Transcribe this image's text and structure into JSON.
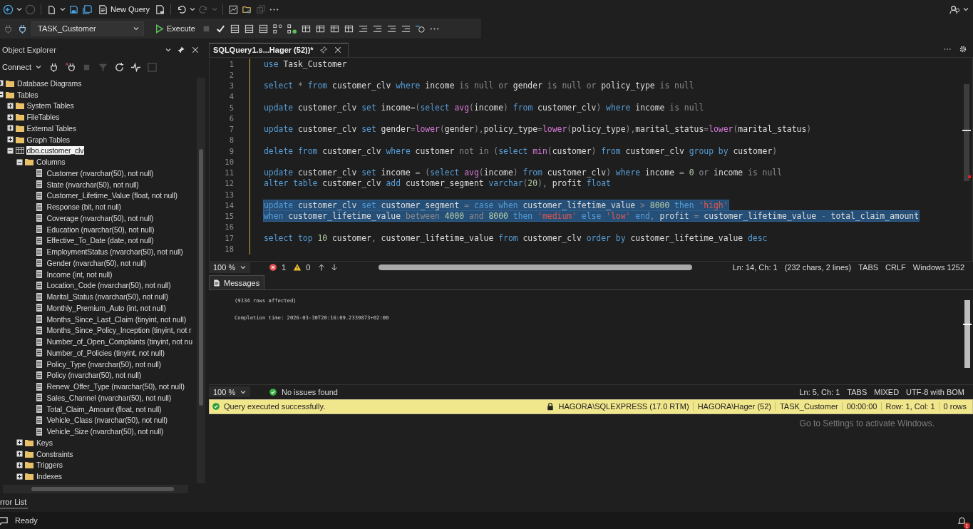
{
  "toolbar": {
    "new_query": "New Query",
    "database": "TASK_Customer",
    "execute": "Execute"
  },
  "object_explorer": {
    "title": "Object Explorer",
    "connect": "Connect",
    "tree": [
      {
        "label": "Database Diagrams",
        "kind": "folder",
        "expanded": false,
        "selected": false
      },
      {
        "label": "Tables",
        "kind": "folder",
        "expanded": true,
        "selected": false,
        "children": [
          {
            "label": "System Tables",
            "kind": "folder",
            "expanded": false,
            "selected": false
          },
          {
            "label": "FileTables",
            "kind": "folder",
            "expanded": false,
            "selected": false
          },
          {
            "label": "External Tables",
            "kind": "folder",
            "expanded": false,
            "selected": false
          },
          {
            "label": "Graph Tables",
            "kind": "folder",
            "expanded": false,
            "selected": false
          },
          {
            "label": "dbo.customer_clv",
            "kind": "table",
            "expanded": true,
            "selected": true,
            "children": [
              {
                "label": "Columns",
                "kind": "folder",
                "expanded": true,
                "selected": false,
                "children": [
                  {
                    "label": "Customer (nvarchar(50), not null)",
                    "kind": "column",
                    "selected": false
                  },
                  {
                    "label": "State (nvarchar(50), not null)",
                    "kind": "column",
                    "selected": false
                  },
                  {
                    "label": "Customer_Lifetime_Value (float, not null)",
                    "kind": "column",
                    "selected": false
                  },
                  {
                    "label": "Response (bit, not null)",
                    "kind": "column",
                    "selected": false
                  },
                  {
                    "label": "Coverage (nvarchar(50), not null)",
                    "kind": "column",
                    "selected": false
                  },
                  {
                    "label": "Education (nvarchar(50), not null)",
                    "kind": "column",
                    "selected": false
                  },
                  {
                    "label": "Effective_To_Date (date, not null)",
                    "kind": "column",
                    "selected": false
                  },
                  {
                    "label": "EmploymentStatus (nvarchar(50), not null)",
                    "kind": "column",
                    "selected": false
                  },
                  {
                    "label": "Gender (nvarchar(50), not null)",
                    "kind": "column",
                    "selected": false
                  },
                  {
                    "label": "Income (int, not null)",
                    "kind": "column",
                    "selected": false
                  },
                  {
                    "label": "Location_Code (nvarchar(50), not null)",
                    "kind": "column",
                    "selected": false
                  },
                  {
                    "label": "Marital_Status (nvarchar(50), not null)",
                    "kind": "column",
                    "selected": false
                  },
                  {
                    "label": "Monthly_Premium_Auto (int, not null)",
                    "kind": "column",
                    "selected": false
                  },
                  {
                    "label": "Months_Since_Last_Claim (tinyint, not null)",
                    "kind": "column",
                    "selected": false
                  },
                  {
                    "label": "Months_Since_Policy_Inception (tinyint, not r",
                    "kind": "column",
                    "selected": false
                  },
                  {
                    "label": "Number_of_Open_Complaints (tinyint, not nu",
                    "kind": "column",
                    "selected": false
                  },
                  {
                    "label": "Number_of_Policies (tinyint, not null)",
                    "kind": "column",
                    "selected": false
                  },
                  {
                    "label": "Policy_Type (nvarchar(50), not null)",
                    "kind": "column",
                    "selected": false
                  },
                  {
                    "label": "Policy (nvarchar(50), not null)",
                    "kind": "column",
                    "selected": false
                  },
                  {
                    "label": "Renew_Offer_Type (nvarchar(50), not null)",
                    "kind": "column",
                    "selected": false
                  },
                  {
                    "label": "Sales_Channel (nvarchar(50), not null)",
                    "kind": "column",
                    "selected": false
                  },
                  {
                    "label": "Total_Claim_Amount (float, not null)",
                    "kind": "column",
                    "selected": false
                  },
                  {
                    "label": "Vehicle_Class (nvarchar(50), not null)",
                    "kind": "column",
                    "selected": false
                  },
                  {
                    "label": "Vehicle_Size (nvarchar(50), not null)",
                    "kind": "column",
                    "selected": false
                  }
                ]
              },
              {
                "label": "Keys",
                "kind": "folder",
                "expanded": false,
                "selected": false
              },
              {
                "label": "Constraints",
                "kind": "folder",
                "expanded": false,
                "selected": false
              },
              {
                "label": "Triggers",
                "kind": "folder",
                "expanded": false,
                "selected": false
              },
              {
                "label": "Indexes",
                "kind": "folder",
                "expanded": false,
                "selected": false
              }
            ]
          }
        ]
      }
    ],
    "error_list_tab": "rror List"
  },
  "editor": {
    "tab": {
      "title": "SQLQuery1.s...Hager (52))*",
      "selected": true
    },
    "lines": [
      {
        "number": "1",
        "selected": false,
        "tokens": [
          {
            "text": "use",
            "kind": "kw"
          },
          {
            "text": " Task_Customer",
            "kind": "id"
          }
        ]
      },
      {
        "number": "2"
      },
      {
        "number": "3",
        "selected": false,
        "tokens": [
          {
            "text": "select",
            "kind": "kw"
          },
          {
            "text": " *",
            "kind": "op"
          },
          {
            "text": " from",
            "kind": "kw"
          },
          {
            "text": " customer_clv",
            "kind": "id"
          },
          {
            "text": " where",
            "kind": "kw"
          },
          {
            "text": " income",
            "kind": "id"
          },
          {
            "text": " is null or",
            "kind": "op"
          },
          {
            "text": " gender",
            "kind": "id"
          },
          {
            "text": " is null or",
            "kind": "op"
          },
          {
            "text": " policy_type",
            "kind": "id"
          },
          {
            "text": " is null",
            "kind": "op"
          }
        ]
      },
      {
        "number": "4"
      },
      {
        "number": "5",
        "selected": false,
        "tokens": [
          {
            "text": "update",
            "kind": "kw"
          },
          {
            "text": " customer_clv",
            "kind": "id"
          },
          {
            "text": " set",
            "kind": "kw"
          },
          {
            "text": " income",
            "kind": "id"
          },
          {
            "text": "=(",
            "kind": "op"
          },
          {
            "text": "select",
            "kind": "kw"
          },
          {
            "text": " avg",
            "kind": "fn"
          },
          {
            "text": "(",
            "kind": "op"
          },
          {
            "text": "income",
            "kind": "id"
          },
          {
            "text": ")",
            "kind": "op"
          },
          {
            "text": " from",
            "kind": "kw"
          },
          {
            "text": " customer_clv",
            "kind": "id"
          },
          {
            "text": ")",
            "kind": "op"
          },
          {
            "text": " where",
            "kind": "kw"
          },
          {
            "text": " income",
            "kind": "id"
          },
          {
            "text": " is null",
            "kind": "op"
          }
        ]
      },
      {
        "number": "6"
      },
      {
        "number": "7",
        "selected": false,
        "tokens": [
          {
            "text": "update",
            "kind": "kw"
          },
          {
            "text": " customer_clv",
            "kind": "id"
          },
          {
            "text": " set",
            "kind": "kw"
          },
          {
            "text": " gender",
            "kind": "id"
          },
          {
            "text": "=",
            "kind": "op"
          },
          {
            "text": "lower",
            "kind": "fn"
          },
          {
            "text": "(",
            "kind": "op"
          },
          {
            "text": "gender",
            "kind": "id"
          },
          {
            "text": "),",
            "kind": "op"
          },
          {
            "text": "policy_type",
            "kind": "id"
          },
          {
            "text": "=",
            "kind": "op"
          },
          {
            "text": "lower",
            "kind": "fn"
          },
          {
            "text": "(",
            "kind": "op"
          },
          {
            "text": "policy_type",
            "kind": "id"
          },
          {
            "text": "),",
            "kind": "op"
          },
          {
            "text": "marital_status",
            "kind": "id"
          },
          {
            "text": "=",
            "kind": "op"
          },
          {
            "text": "lower",
            "kind": "fn"
          },
          {
            "text": "(",
            "kind": "op"
          },
          {
            "text": "marital_status",
            "kind": "id"
          },
          {
            "text": ")",
            "kind": "op"
          }
        ]
      },
      {
        "number": "8"
      },
      {
        "number": "9",
        "selected": false,
        "tokens": [
          {
            "text": "delete from",
            "kind": "kw"
          },
          {
            "text": " customer_clv",
            "kind": "id"
          },
          {
            "text": " where",
            "kind": "kw"
          },
          {
            "text": " customer",
            "kind": "id"
          },
          {
            "text": " not in (",
            "kind": "op"
          },
          {
            "text": "select",
            "kind": "kw"
          },
          {
            "text": " min",
            "kind": "fn"
          },
          {
            "text": "(",
            "kind": "op"
          },
          {
            "text": "customer",
            "kind": "id"
          },
          {
            "text": ")",
            "kind": "op"
          },
          {
            "text": " from",
            "kind": "kw"
          },
          {
            "text": " customer_clv",
            "kind": "id"
          },
          {
            "text": " group by",
            "kind": "kw"
          },
          {
            "text": " customer",
            "kind": "id"
          },
          {
            "text": ")",
            "kind": "op"
          }
        ]
      },
      {
        "number": "10"
      },
      {
        "number": "11",
        "selected": false,
        "tokens": [
          {
            "text": "update",
            "kind": "kw"
          },
          {
            "text": " customer_clv",
            "kind": "id"
          },
          {
            "text": " set",
            "kind": "kw"
          },
          {
            "text": " income",
            "kind": "id"
          },
          {
            "text": " = (",
            "kind": "op"
          },
          {
            "text": "select",
            "kind": "kw"
          },
          {
            "text": " avg",
            "kind": "fn"
          },
          {
            "text": "(",
            "kind": "op"
          },
          {
            "text": "income",
            "kind": "id"
          },
          {
            "text": ")",
            "kind": "op"
          },
          {
            "text": " from",
            "kind": "kw"
          },
          {
            "text": " customer_clv",
            "kind": "id"
          },
          {
            "text": ")",
            "kind": "op"
          },
          {
            "text": " where",
            "kind": "kw"
          },
          {
            "text": " income",
            "kind": "id"
          },
          {
            "text": " =",
            "kind": "op"
          },
          {
            "text": " 0",
            "kind": "num"
          },
          {
            "text": " or",
            "kind": "op"
          },
          {
            "text": " income",
            "kind": "id"
          },
          {
            "text": " is null",
            "kind": "op"
          }
        ]
      },
      {
        "number": "12",
        "selected": false,
        "tokens": [
          {
            "text": "alter table",
            "kind": "kw"
          },
          {
            "text": " customer_clv",
            "kind": "id"
          },
          {
            "text": " add",
            "kind": "kw"
          },
          {
            "text": " customer_segment",
            "kind": "id"
          },
          {
            "text": " varchar",
            "kind": "kw"
          },
          {
            "text": "(",
            "kind": "op"
          },
          {
            "text": "20",
            "kind": "num"
          },
          {
            "text": "),",
            "kind": "op"
          },
          {
            "text": " profit",
            "kind": "id"
          },
          {
            "text": " float",
            "kind": "kw"
          }
        ]
      },
      {
        "number": "13"
      },
      {
        "number": "14",
        "selected": true,
        "tokens": [
          {
            "text": "update",
            "kind": "kw"
          },
          {
            "text": " customer_clv",
            "kind": "id"
          },
          {
            "text": " set",
            "kind": "kw"
          },
          {
            "text": " customer_segment",
            "kind": "id"
          },
          {
            "text": " =",
            "kind": "op"
          },
          {
            "text": " case when",
            "kind": "kw"
          },
          {
            "text": " customer_lifetime_value",
            "kind": "id"
          },
          {
            "text": " >",
            "kind": "op"
          },
          {
            "text": " 8000",
            "kind": "num"
          },
          {
            "text": " then",
            "kind": "kw"
          },
          {
            "text": " 'high'",
            "kind": "str"
          }
        ]
      },
      {
        "number": "15",
        "selected": true,
        "tokens": [
          {
            "text": "when",
            "kind": "kw"
          },
          {
            "text": " customer_lifetime_value",
            "kind": "id"
          },
          {
            "text": " between",
            "kind": "op"
          },
          {
            "text": " 4000",
            "kind": "num"
          },
          {
            "text": " and",
            "kind": "op"
          },
          {
            "text": " 8000",
            "kind": "num"
          },
          {
            "text": " then",
            "kind": "kw"
          },
          {
            "text": " 'medium'",
            "kind": "str"
          },
          {
            "text": " else",
            "kind": "kw"
          },
          {
            "text": " 'low'",
            "kind": "str"
          },
          {
            "text": " end",
            "kind": "kw"
          },
          {
            "text": ",",
            "kind": "op"
          },
          {
            "text": " profit",
            "kind": "id"
          },
          {
            "text": " =",
            "kind": "op"
          },
          {
            "text": " customer_lifetime_value",
            "kind": "id"
          },
          {
            "text": " -",
            "kind": "op"
          },
          {
            "text": " total_claim_amount",
            "kind": "id"
          }
        ]
      },
      {
        "number": "16"
      },
      {
        "number": "17",
        "selected": false,
        "tokens": [
          {
            "text": "select top",
            "kind": "kw"
          },
          {
            "text": " 10",
            "kind": "num"
          },
          {
            "text": " customer",
            "kind": "id"
          },
          {
            "text": ",",
            "kind": "op"
          },
          {
            "text": " customer_lifetime_value",
            "kind": "id"
          },
          {
            "text": " from",
            "kind": "kw"
          },
          {
            "text": " customer_clv",
            "kind": "id"
          },
          {
            "text": " order by",
            "kind": "kw"
          },
          {
            "text": " customer_lifetime_value",
            "kind": "id"
          },
          {
            "text": " desc",
            "kind": "kw"
          }
        ]
      },
      {
        "number": "18"
      }
    ],
    "status": {
      "zoom": "100 %",
      "errors": "1",
      "warnings": "0",
      "position": "Ln: 14, Ch: 1",
      "selection": "(232 chars, 2 lines)",
      "indent": "TABS",
      "line_endings": "CRLF",
      "encoding": "Windows 1252"
    }
  },
  "results": {
    "tab": {
      "title": "Messages",
      "selected": true
    },
    "messages": [
      "(9134 rows affected)",
      "Completion time: 2026-03-30T20:16:09.2339873+02:00"
    ],
    "status": {
      "zoom": "100 %",
      "issues": "No issues found",
      "position": "Ln: 5, Ch: 1",
      "indent": "TABS",
      "line_endings": "MIXED",
      "encoding": "UTF-8 with BOM"
    }
  },
  "query_status": {
    "message": "Query executed successfully.",
    "server": "HAGORA\\SQLEXPRESS (17.0 RTM)",
    "login": "HAGORA\\Hager (52)",
    "database": "TASK_Customer",
    "elapsed": "00:00:00",
    "cursor": "Row: 1, Col: 1",
    "rows": "0 rows"
  },
  "status_bar": {
    "text": "Ready",
    "notifications": "1"
  },
  "activation_notice": "Go to Settings to activate Windows."
}
